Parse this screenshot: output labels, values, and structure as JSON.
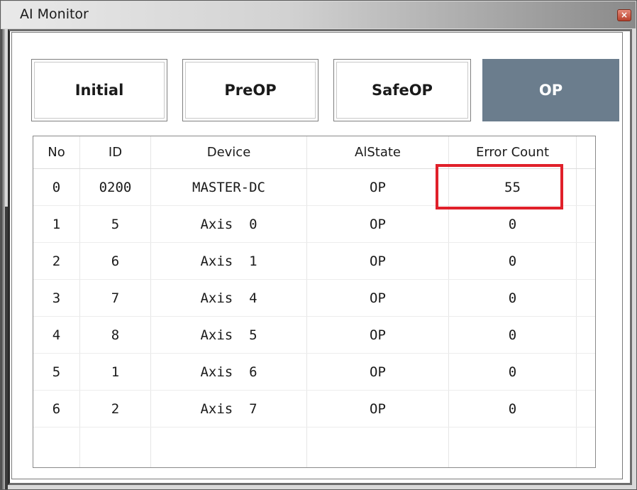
{
  "window": {
    "title": "AI Monitor",
    "close_glyph": "×"
  },
  "state_buttons": [
    {
      "label": "Initial",
      "active": false
    },
    {
      "label": "PreOP",
      "active": false
    },
    {
      "label": "SafeOP",
      "active": false
    },
    {
      "label": "OP",
      "active": true
    }
  ],
  "table": {
    "columns": [
      "No",
      "ID",
      "Device",
      "AlState",
      "Error Count"
    ],
    "rows": [
      {
        "no": "0",
        "id": "0200",
        "device": "MASTER-DC",
        "state": "OP",
        "errors": "55"
      },
      {
        "no": "1",
        "id": "5",
        "device": "Axis  0",
        "state": "OP",
        "errors": "0"
      },
      {
        "no": "2",
        "id": "6",
        "device": "Axis  1",
        "state": "OP",
        "errors": "0"
      },
      {
        "no": "3",
        "id": "7",
        "device": "Axis  4",
        "state": "OP",
        "errors": "0"
      },
      {
        "no": "4",
        "id": "8",
        "device": "Axis  5",
        "state": "OP",
        "errors": "0"
      },
      {
        "no": "5",
        "id": "1",
        "device": "Axis  6",
        "state": "OP",
        "errors": "0"
      },
      {
        "no": "6",
        "id": "2",
        "device": "Axis  7",
        "state": "OP",
        "errors": "0"
      }
    ]
  },
  "colors": {
    "active_button": "#6b7d8d",
    "highlight": "#e0202a"
  }
}
